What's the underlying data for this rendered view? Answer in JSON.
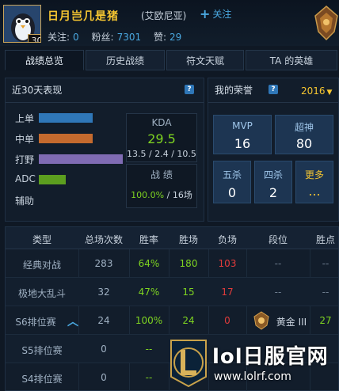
{
  "header": {
    "summoner_name": "日月岂几是猪",
    "level": "30",
    "server": "(艾欧尼亚)",
    "follow_label": "关注",
    "follow_label_prefix": "关注:",
    "follow_count": "0",
    "fans_label": "粉丝:",
    "fans_count": "7301",
    "likes_label": "赞:",
    "likes_count": "29"
  },
  "tabs": [
    "战绩总览",
    "历史战绩",
    "符文天赋",
    "TA 的英雄"
  ],
  "recent": {
    "title": "近30天表现",
    "roles": [
      {
        "label": "上单",
        "value": 0.56,
        "color": "#2f77b8"
      },
      {
        "label": "中单",
        "value": 0.56,
        "color": "#c46a2e"
      },
      {
        "label": "打野",
        "value": 1.0,
        "color": "#7f6bb3"
      },
      {
        "label": "ADC",
        "value": 0.28,
        "color": "#5c9e1f"
      },
      {
        "label": "辅助",
        "value": 0,
        "color": "#4a5a6a"
      }
    ],
    "kda_title": "KDA",
    "kda_value": "29.5",
    "kda_detail": "13.5 / 2.4 / 10.5",
    "record_title": "战  绩",
    "winrate": "100.0%",
    "games": "16场"
  },
  "honor": {
    "title": "我的荣誉",
    "year": "2016",
    "cards": [
      {
        "label": "MVP",
        "value": "16"
      },
      {
        "label": "超神",
        "value": "80"
      },
      {
        "label": "五杀",
        "value": "0"
      },
      {
        "label": "四杀",
        "value": "2"
      },
      {
        "label": "更多",
        "value": "..."
      }
    ]
  },
  "table": {
    "headers": [
      "类型",
      "总场次数",
      "胜率",
      "胜场",
      "负场",
      "段位",
      "胜点"
    ],
    "rows": [
      {
        "type": "经典对战",
        "total": "283",
        "winrate": "64%",
        "wins": "180",
        "losses": "103",
        "tier": "--",
        "points": "--"
      },
      {
        "type": "极地大乱斗",
        "total": "32",
        "winrate": "47%",
        "wins": "15",
        "losses": "17",
        "tier": "--",
        "points": "--"
      },
      {
        "type": "S6排位赛",
        "total": "24",
        "winrate": "100%",
        "wins": "24",
        "losses": "0",
        "tier": "黄金 III",
        "points": "27"
      },
      {
        "type": "S5排位赛",
        "total": "0",
        "winrate": "--",
        "wins": "",
        "losses": "",
        "tier": "",
        "points": ""
      },
      {
        "type": "S4排位赛",
        "total": "0",
        "winrate": "--",
        "wins": "",
        "losses": "",
        "tier": "",
        "points": ""
      }
    ]
  },
  "watermark": {
    "title": "lol日服官网",
    "url": "www.lolrf.com"
  },
  "colors": {
    "gold": "#f4c531",
    "accent_blue": "#4aa8e0",
    "green": "#7ed321",
    "red": "#e03b3b"
  }
}
